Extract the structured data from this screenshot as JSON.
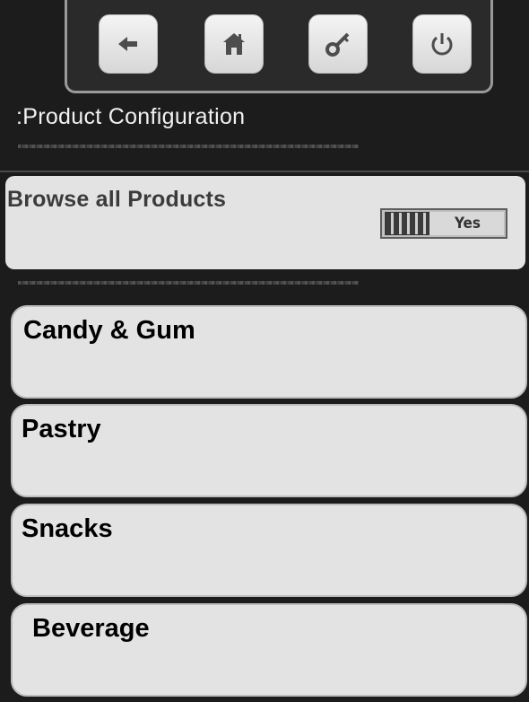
{
  "header": {
    "title": ":Product Configuration"
  },
  "toolbar": {
    "buttons": [
      {
        "icon": "back-arrow-icon"
      },
      {
        "icon": "home-icon"
      },
      {
        "icon": "key-icon"
      },
      {
        "icon": "power-icon"
      }
    ]
  },
  "browse": {
    "label": "Browse all Products",
    "toggle_value": "Yes"
  },
  "categories": [
    {
      "label": "Candy & Gum"
    },
    {
      "label": "Pastry"
    },
    {
      "label": "Snacks"
    },
    {
      "label": "Beverage"
    }
  ],
  "colors": {
    "background": "#1c1c1c",
    "panel": "#e3e3e3",
    "title_text": "#f1f1f1"
  }
}
